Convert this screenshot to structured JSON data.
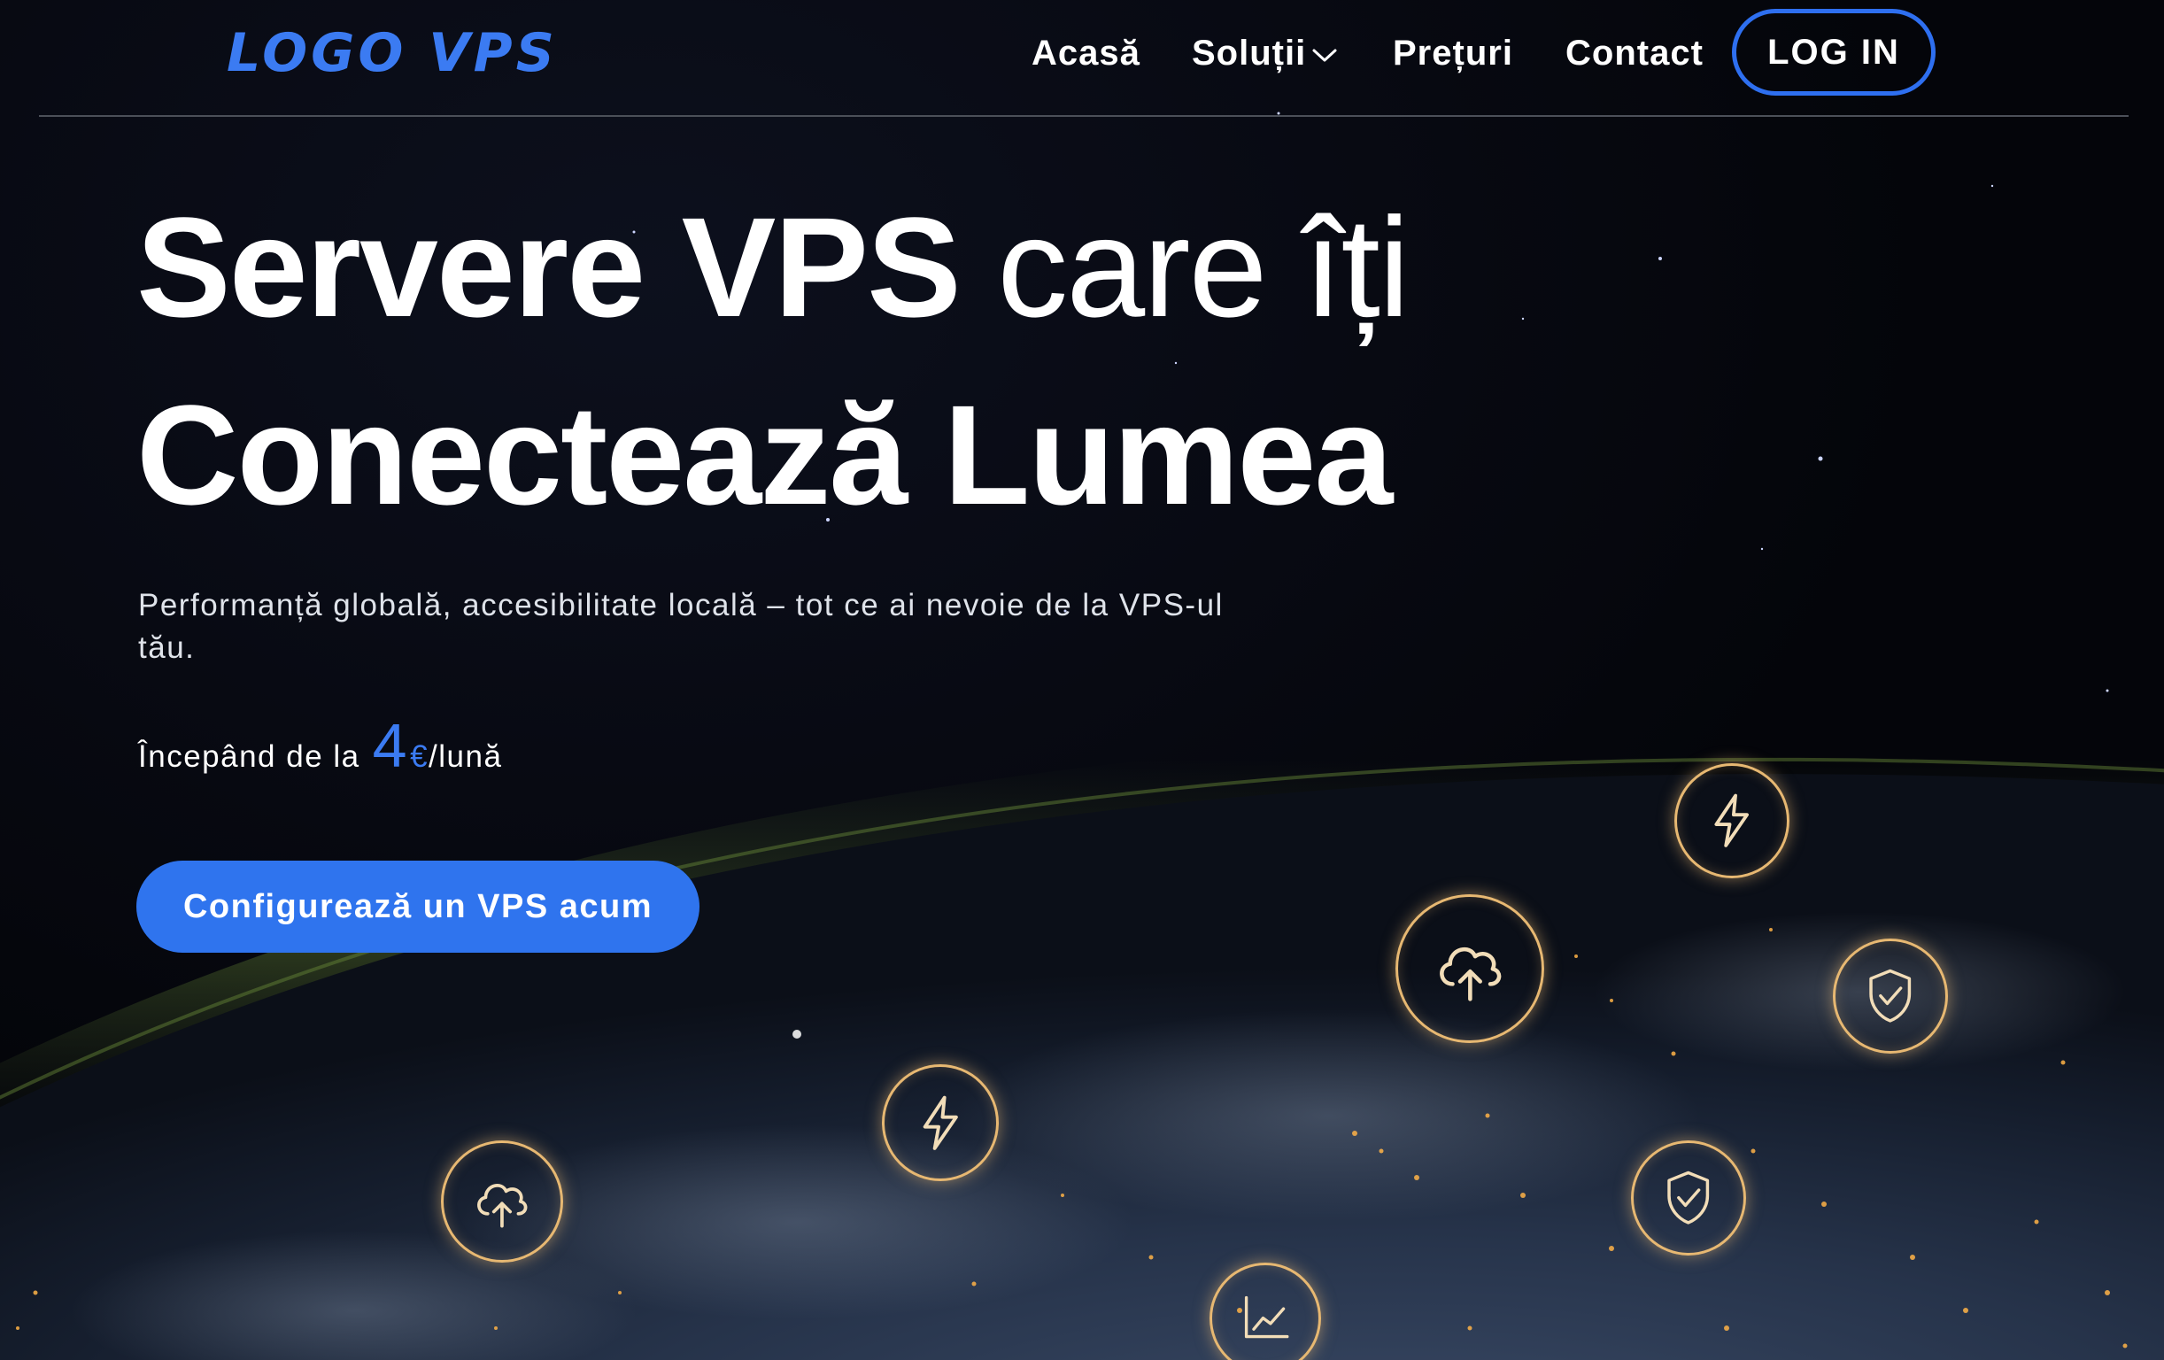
{
  "header": {
    "logo": "LOGO VPS",
    "nav": [
      {
        "label": "Acasă",
        "has_dropdown": false
      },
      {
        "label": "Soluții",
        "has_dropdown": true
      },
      {
        "label": "Prețuri",
        "has_dropdown": false
      },
      {
        "label": "Contact",
        "has_dropdown": false
      }
    ],
    "login_label": "LOG IN"
  },
  "hero": {
    "title_line1_strong": "Servere VPS",
    "title_line1_light": " care îți",
    "title_line2": "Conectează Lumea",
    "subtitle": "Performanță globală, accesibilitate locală – tot ce ai nevoie de la VPS-ul tău.",
    "price_prefix": "Începând de la",
    "price_value": "4",
    "price_currency": "€",
    "price_suffix": "/lună",
    "cta_label": "Configurează un VPS acum"
  },
  "floating_icons": [
    {
      "name": "lightning-icon"
    },
    {
      "name": "cloud-upload-icon"
    },
    {
      "name": "shield-check-icon"
    },
    {
      "name": "lightning-icon"
    },
    {
      "name": "cloud-upload-icon"
    },
    {
      "name": "shield-check-icon"
    },
    {
      "name": "chart-icon"
    }
  ],
  "colors": {
    "background": "#04050a",
    "accent": "#3b7bf2",
    "button": "#2f74ee",
    "icon_glow": "#e7b872",
    "text": "#ffffff"
  }
}
